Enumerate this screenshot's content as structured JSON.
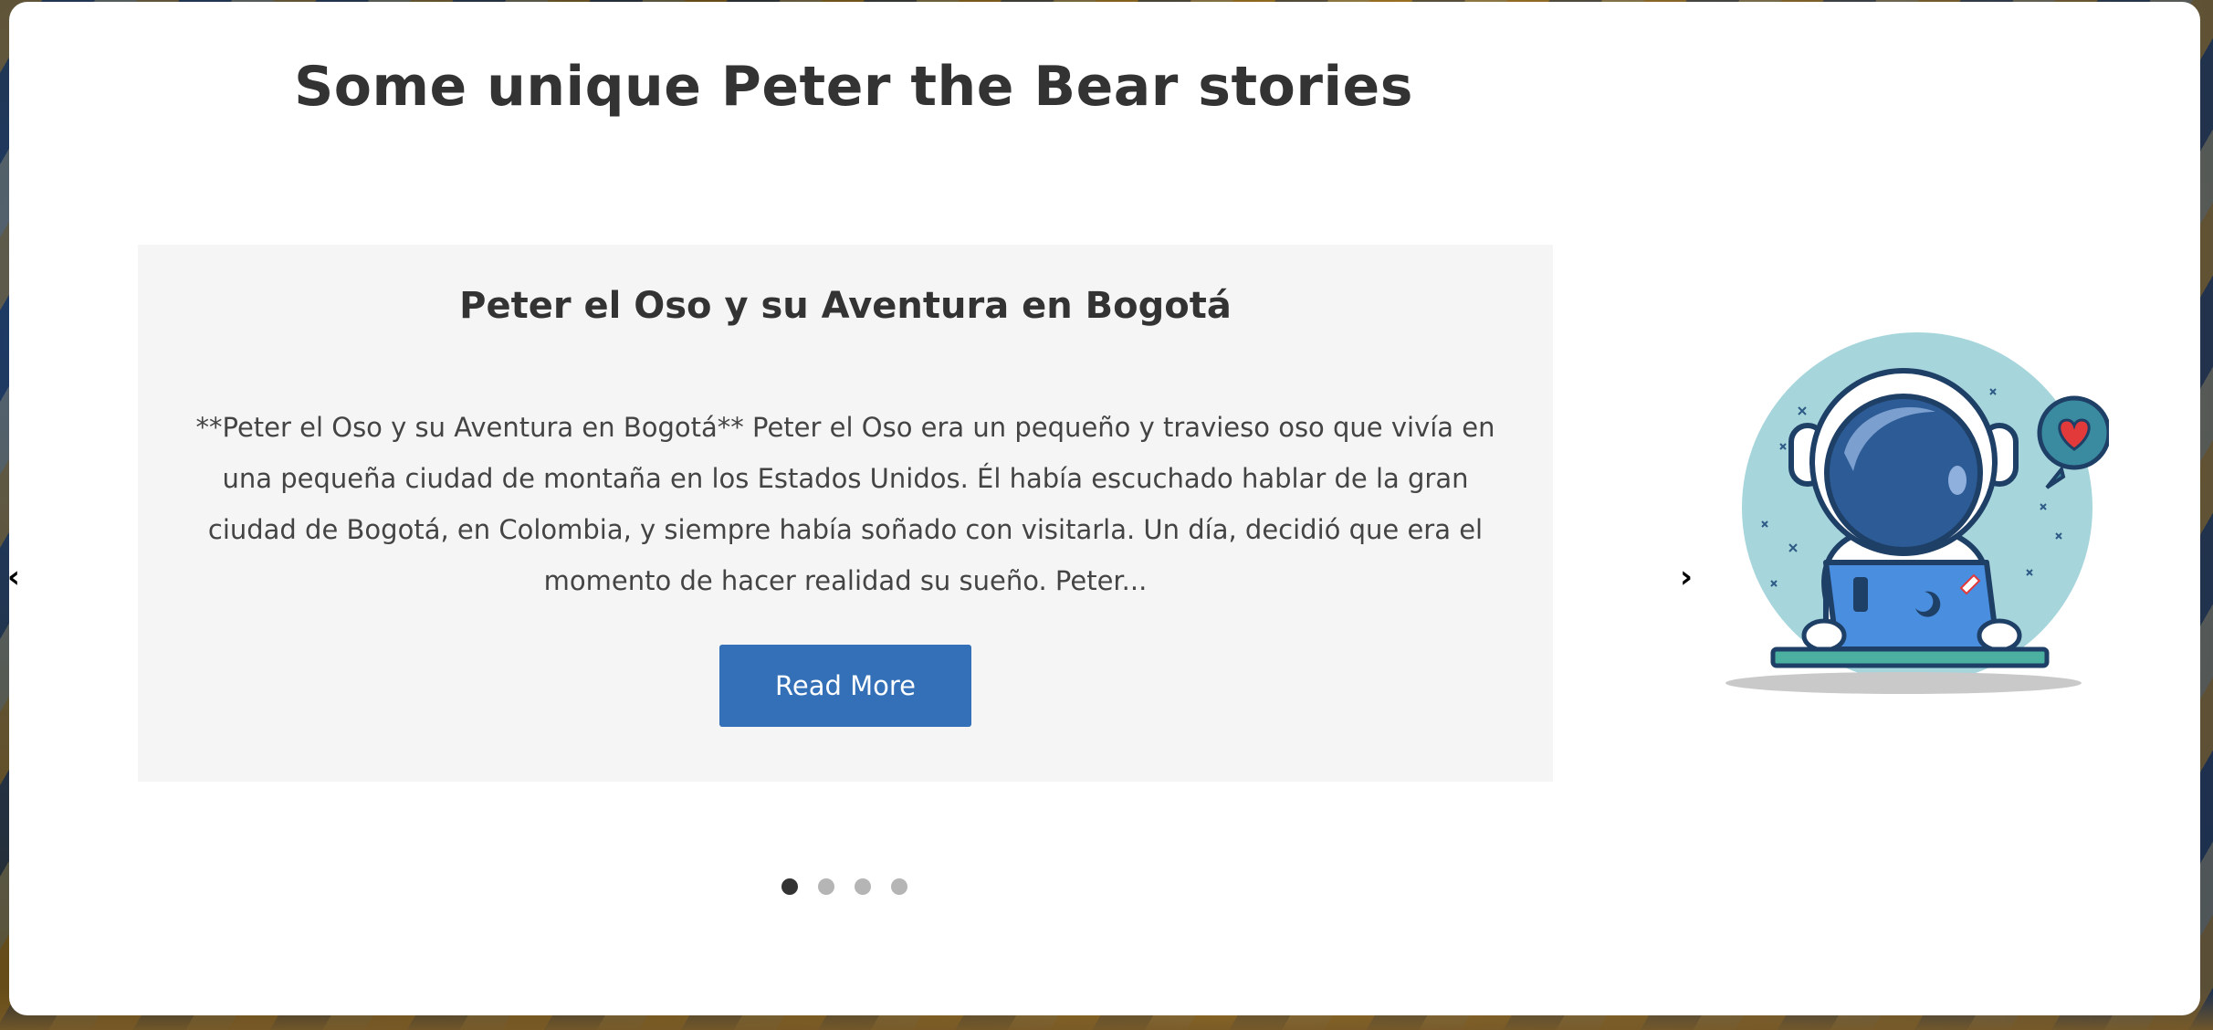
{
  "section": {
    "title": "Some unique Peter the Bear stories"
  },
  "carousel": {
    "prev_icon": "chevron-left-icon",
    "next_icon": "chevron-right-icon",
    "active_slide": 1,
    "slide_count": 4,
    "slide": {
      "title": "Peter el Oso y su Aventura en Bogotá",
      "excerpt": "**Peter el Oso y su Aventura en Bogotá** Peter el Oso era un pequeño y travieso oso que vivía en una pequeña ciudad de montaña en los Estados Unidos. Él había escuchado hablar de la gran ciudad de Bogotá, en Colombia, y siempre había soñado con visitarla. Un día, decidió que era el momento de hacer realidad su sueño. Peter...",
      "button_label": "Read More",
      "illustration": "astronaut-with-laptop-illustration"
    }
  },
  "colors": {
    "button": "#3370b7",
    "card_bg": "#f5f5f5",
    "title_text": "#333333",
    "dot_active": "#333333",
    "dot_inactive": "#b5b5b5"
  }
}
